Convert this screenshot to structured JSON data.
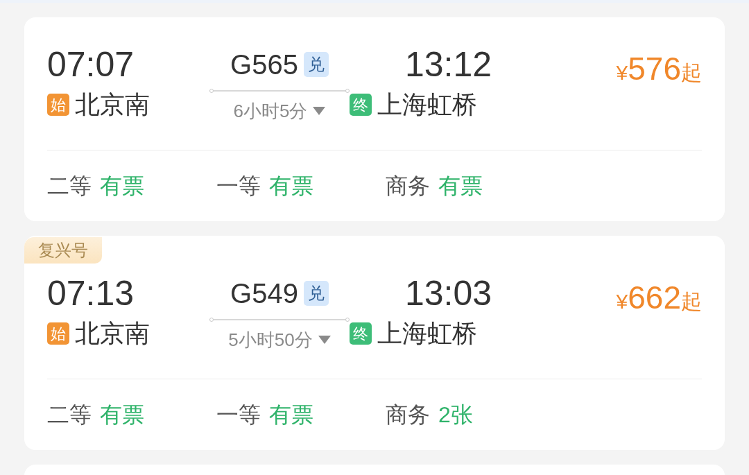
{
  "trains": [
    {
      "depart_time": "07:07",
      "depart_tag": "始",
      "depart_station": "北京南",
      "train_no": "G565",
      "train_tag": "兑",
      "duration": "6小时5分",
      "arrive_time": "13:12",
      "arrive_tag": "终",
      "arrive_station": "上海虹桥",
      "currency": "¥",
      "price": "576",
      "price_suffix": "起",
      "seats": [
        {
          "class": "二等",
          "status": "有票"
        },
        {
          "class": "一等",
          "status": "有票"
        },
        {
          "class": "商务",
          "status": "有票"
        }
      ]
    },
    {
      "badge": "复兴号",
      "depart_time": "07:13",
      "depart_tag": "始",
      "depart_station": "北京南",
      "train_no": "G549",
      "train_tag": "兑",
      "duration": "5小时50分",
      "arrive_time": "13:03",
      "arrive_tag": "终",
      "arrive_station": "上海虹桥",
      "currency": "¥",
      "price": "662",
      "price_suffix": "起",
      "seats": [
        {
          "class": "二等",
          "status": "有票"
        },
        {
          "class": "一等",
          "status": "有票"
        },
        {
          "class": "商务",
          "status": "2张"
        }
      ]
    }
  ]
}
